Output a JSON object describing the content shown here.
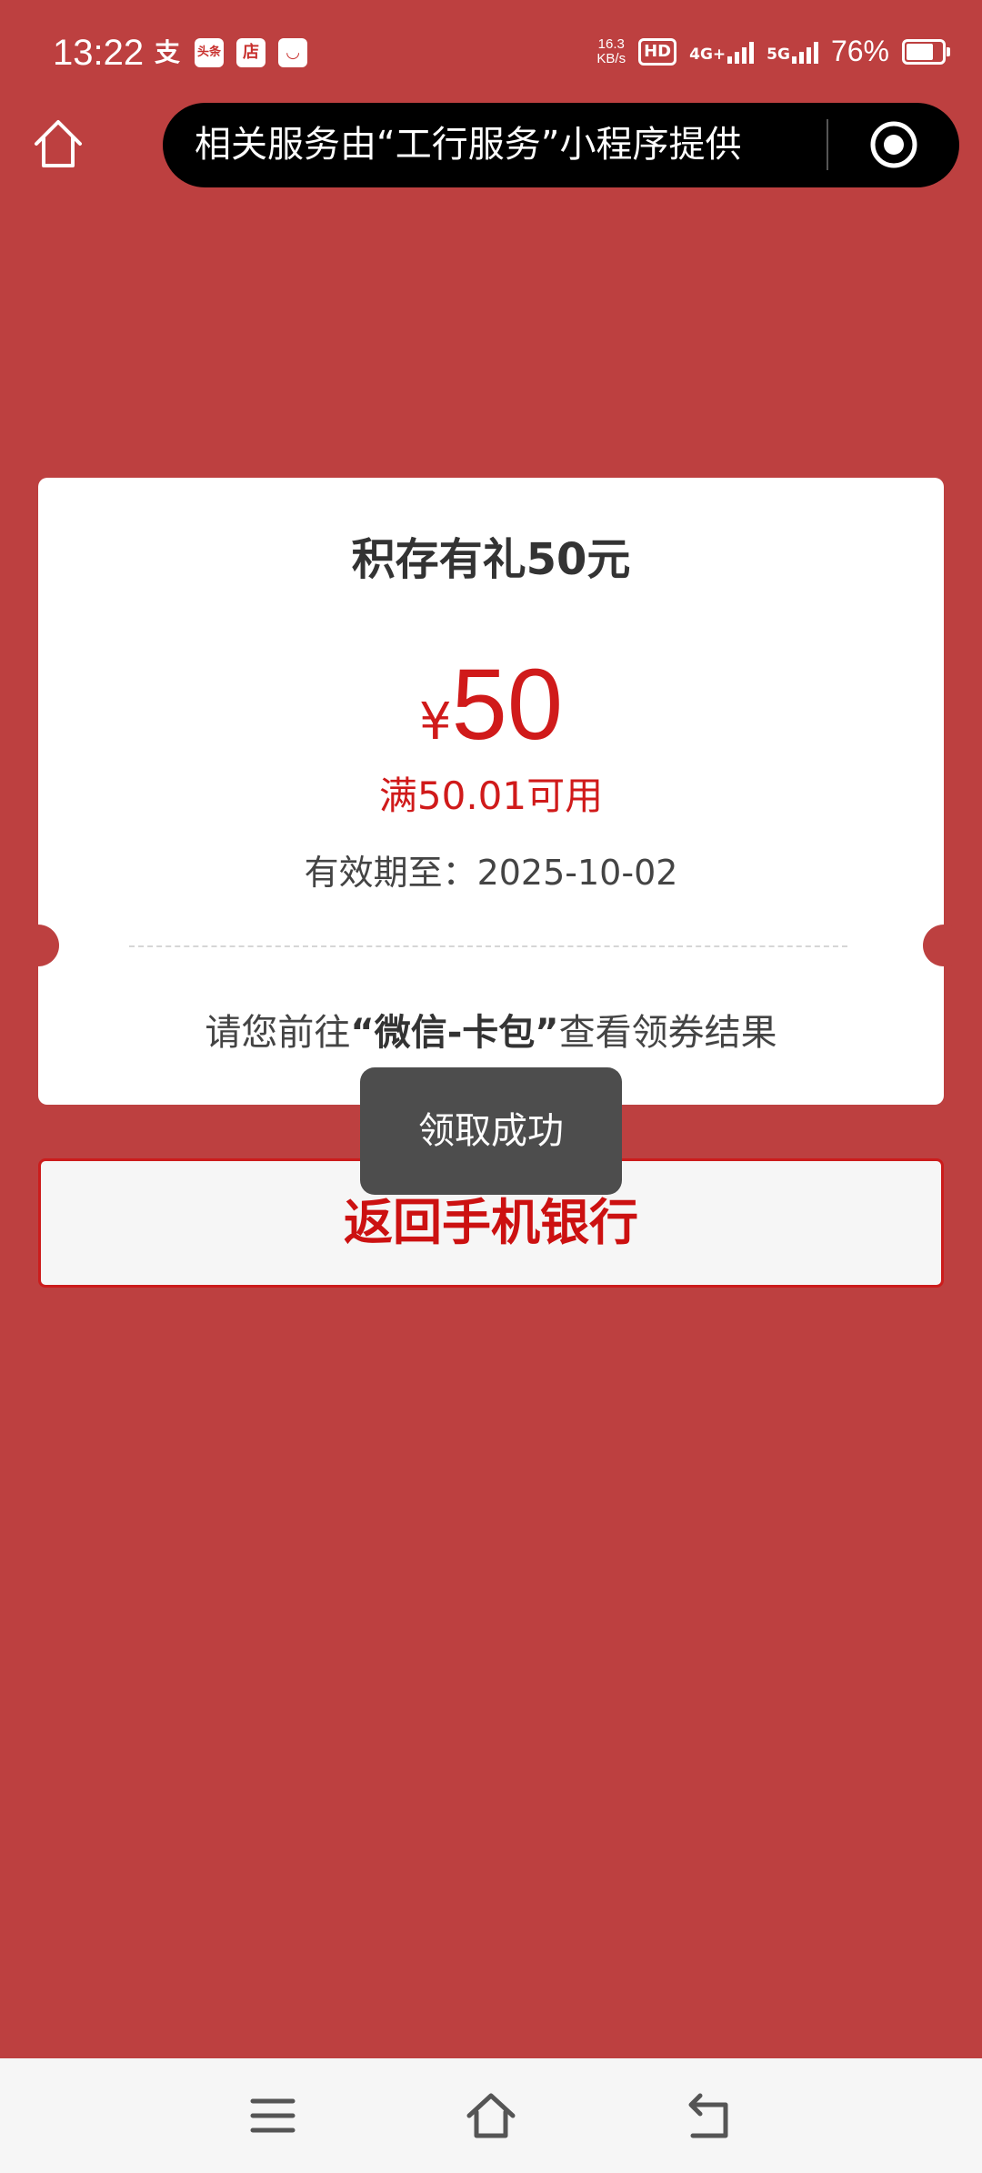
{
  "status_bar": {
    "time": "13:22",
    "app_icons": [
      {
        "name": "alipay-icon",
        "glyph": "支"
      },
      {
        "name": "toutiao-icon",
        "glyph": "头条"
      },
      {
        "name": "shopping-app-icon",
        "glyph": "店"
      },
      {
        "name": "shopping-bag-icon",
        "glyph": "◡"
      }
    ],
    "net_speed_value": "16.3",
    "net_speed_unit": "KB/s",
    "hd_label": "HD",
    "network_1": "4G+",
    "network_2": "5G",
    "battery_percent": "76%",
    "battery_level": 0.76
  },
  "header": {
    "notice": "相关服务由“工行服务”小程序提供"
  },
  "coupon": {
    "title": "积存有礼50元",
    "currency": "¥",
    "amount": "50",
    "condition": "满50.01可用",
    "validity": "有效期至：2025-10-02",
    "hint_before": "请您前往",
    "hint_bold": "“微信-卡包”",
    "hint_after": "查看领券结果"
  },
  "actions": {
    "return_label": "返回手机银行"
  },
  "toast": {
    "message": "领取成功"
  },
  "colors": {
    "background": "#bd4040",
    "accent_red": "#d01a1a",
    "card": "#ffffff",
    "toast": "#4d4d4d",
    "capsule": "#000000"
  }
}
